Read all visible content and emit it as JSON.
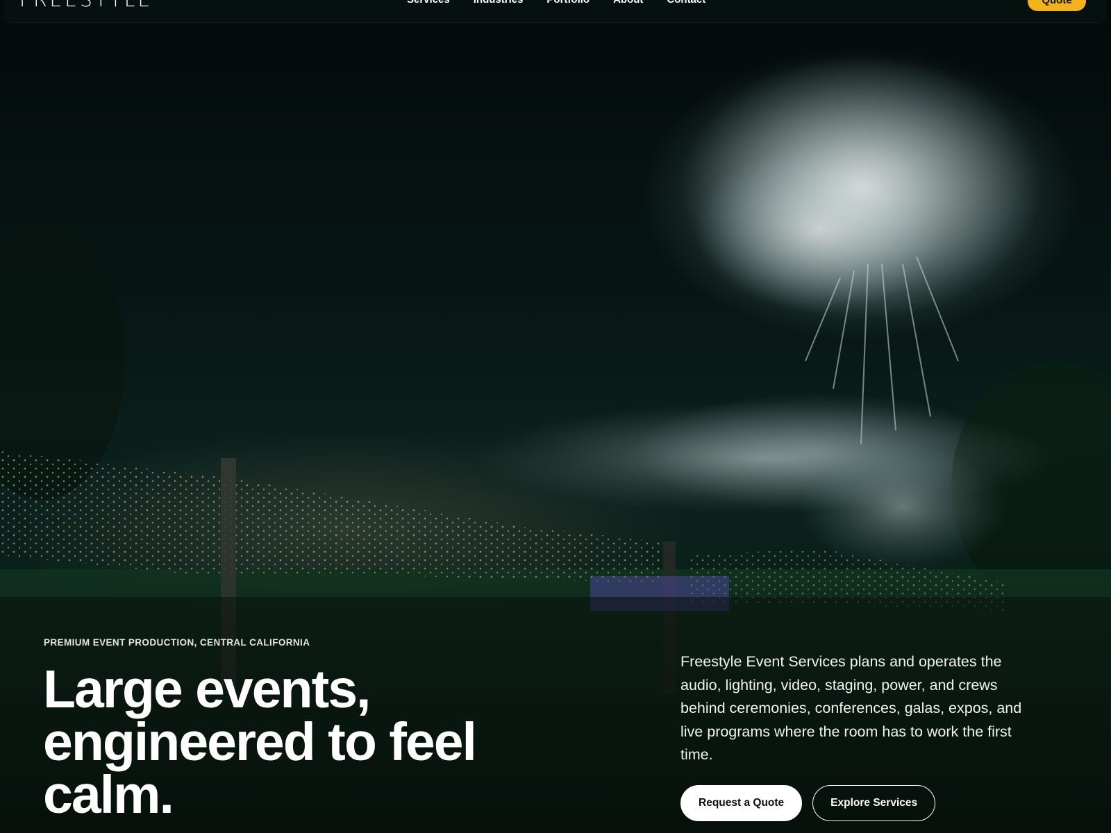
{
  "brand": {
    "logo_text": "FREESTYLE"
  },
  "nav": {
    "links": [
      "Services",
      "Industries",
      "Portfolio",
      "About",
      "Contact"
    ],
    "quote_label": "Quote"
  },
  "hero": {
    "eyebrow": "PREMIUM EVENT PRODUCTION, CENTRAL CALIFORNIA",
    "title_lines": [
      "Large events,",
      "engineered to feel",
      "calm."
    ],
    "description": "Freestyle Event Services plans and operates the audio, lighting, video, staging, power, and crews behind ceremonies, conferences, galas, expos, and live programs where the room has to work the first time.",
    "primary_cta": "Request a Quote",
    "secondary_cta": "Explore Services",
    "background_image": "fireworks-over-outdoor-event-photo"
  },
  "colors": {
    "accent": "#f2b21c",
    "nav_background": "#06100f",
    "text": "#ffffff"
  }
}
